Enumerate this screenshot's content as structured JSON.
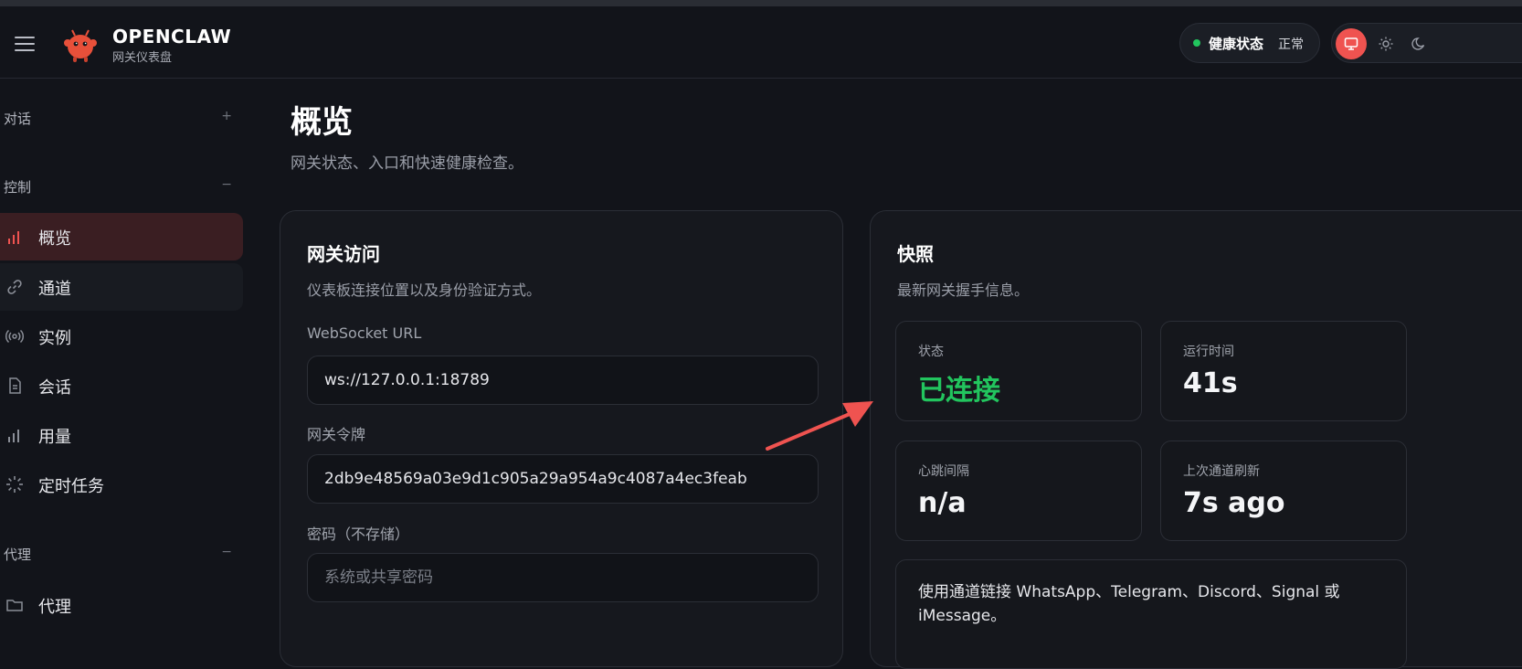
{
  "header": {
    "brand_title": "OPENCLAW",
    "brand_subtitle": "网关仪表盘",
    "health_label": "健康状态",
    "health_value": "正常",
    "status_color": "#22c55e",
    "accent_color": "#ef5350",
    "theme_buttons": [
      "monitor-icon",
      "sun-icon",
      "moon-icon"
    ]
  },
  "sidebar": {
    "sections": [
      {
        "title": "对话",
        "toggle": "+"
      },
      {
        "title": "控制",
        "toggle": "−"
      },
      {
        "title": "代理",
        "toggle": "−"
      }
    ],
    "items": [
      {
        "label": "概览",
        "icon": "bar-chart-icon"
      },
      {
        "label": "通道",
        "icon": "link-icon"
      },
      {
        "label": "实例",
        "icon": "broadcast-icon"
      },
      {
        "label": "会话",
        "icon": "document-icon"
      },
      {
        "label": "用量",
        "icon": "bar-chart-icon"
      },
      {
        "label": "定时任务",
        "icon": "loader-icon"
      },
      {
        "label": "代理",
        "icon": "folder-icon"
      }
    ]
  },
  "main": {
    "title": "概览",
    "subtitle": "网关状态、入口和快速健康检查。"
  },
  "access_card": {
    "title": "网关访问",
    "subtitle": "仪表板连接位置以及身份验证方式。",
    "ws_label": "WebSocket URL",
    "ws_value": "ws://127.0.0.1:18789",
    "token_label": "网关令牌",
    "token_value": "2db9e48569a03e9d1c905a29a954a9c4087a4ec3feab",
    "password_label": "密码（不存储）",
    "password_placeholder": "系统或共享密码"
  },
  "snapshot_card": {
    "title": "快照",
    "subtitle": "最新网关握手信息。",
    "stats": [
      {
        "label": "状态",
        "value": "已连接"
      },
      {
        "label": "运行时间",
        "value": "41s"
      },
      {
        "label": "心跳间隔",
        "value": "n/a"
      },
      {
        "label": "上次通道刷新",
        "value": "7s ago"
      }
    ],
    "note": "使用通道链接 WhatsApp、Telegram、Discord、Signal 或 iMessage。"
  }
}
